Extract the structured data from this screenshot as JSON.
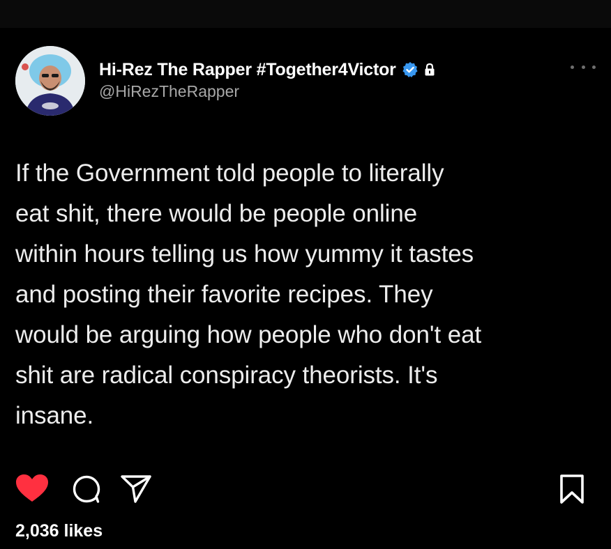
{
  "post": {
    "author": {
      "display_name": "Hi-Rez The Rapper #Together4Victor",
      "handle": "@HiRezTheRapper",
      "avatar_icon": "user-avatar",
      "verified_icon": "verified-badge-icon",
      "lock_icon": "lock-icon"
    },
    "text_lines": [
      "If the Government told people to literally",
      "eat shit, there would be people online",
      "within hours telling us how yummy it tastes",
      "and posting their favorite recipes. They",
      "would be arguing how people who don't eat",
      "shit are radical conspiracy theorists. It's",
      "insane."
    ],
    "likes": "2,036 likes",
    "liked": true
  },
  "icons": {
    "more": "more-options-icon",
    "like": "heart-icon",
    "comment": "comment-icon",
    "share": "share-icon",
    "save": "bookmark-icon"
  },
  "colors": {
    "background": "#000000",
    "text": "#ffffff",
    "secondary_text": "#a8a8a8",
    "like_red": "#ff3040",
    "verified_blue": "#3897f0"
  }
}
